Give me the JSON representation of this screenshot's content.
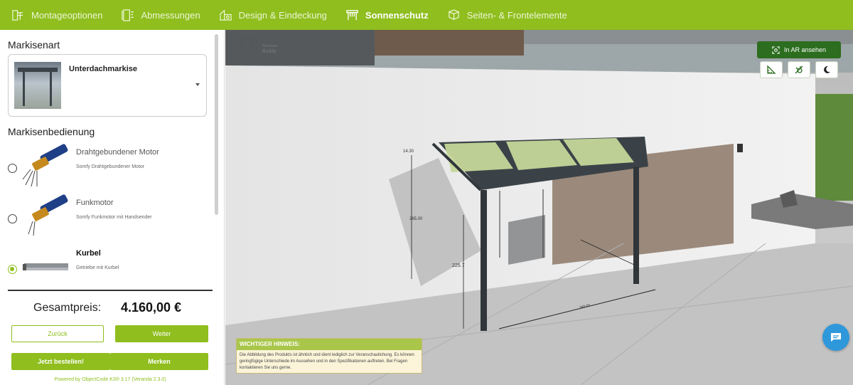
{
  "nav": {
    "items": [
      {
        "label": "Montageoptionen",
        "icon": "mounting-icon"
      },
      {
        "label": "Abmessungen",
        "icon": "dimensions-icon"
      },
      {
        "label": "Design & Eindeckung",
        "icon": "design-icon"
      },
      {
        "label": "Sonnenschutz",
        "icon": "sunshade-icon",
        "active": true
      },
      {
        "label": "Seiten- & Frontelemente",
        "icon": "side-elements-icon"
      }
    ]
  },
  "markisenart": {
    "title": "Markisenart",
    "selected": "Unterdachmarkise"
  },
  "bedienung": {
    "title": "Markisenbedienung",
    "options": [
      {
        "title": "Drahtgebundener Motor",
        "subtitle": "Somfy Drahtgebundener Motor",
        "selected": false
      },
      {
        "title": "Funkmotor",
        "subtitle": "Somfy Funkmotor mit Handsender",
        "selected": false
      },
      {
        "title": "Kurbel",
        "subtitle": "Getriebe mit Kurbel",
        "selected": true
      }
    ]
  },
  "price": {
    "label": "Gesamtpreis:",
    "value": "4.160,00 €"
  },
  "buttons": {
    "back": "Zurück",
    "next": "Weiter",
    "order": "Jetzt bestellen!",
    "remember": "Merken"
  },
  "powered_by": "Powered by ObjectCode K3® 3.17 (Veranda 2.3.0)",
  "viewer": {
    "ar_label": "In AR ansehen",
    "logo_line1": "Terrassen",
    "logo_line2": "Buddy",
    "dims": {
      "top": "14.30",
      "height": "265.00",
      "depth": "225.7",
      "width": "349.00"
    },
    "hint_title": "WICHTIGER HINWEIS:",
    "hint_text": "Die Abbildung des Produkts ist ähnlich und dient lediglich zur Veranschaulichung. Es können geringfügige Unterschiede im Aussehen und in den Spezifikationen auftreten. Bei Fragen kontaktieren Sie uns gerne."
  },
  "colors": {
    "accent": "#8fbe1e",
    "ar_button": "#2c6d1f",
    "chat": "#2e98db"
  }
}
